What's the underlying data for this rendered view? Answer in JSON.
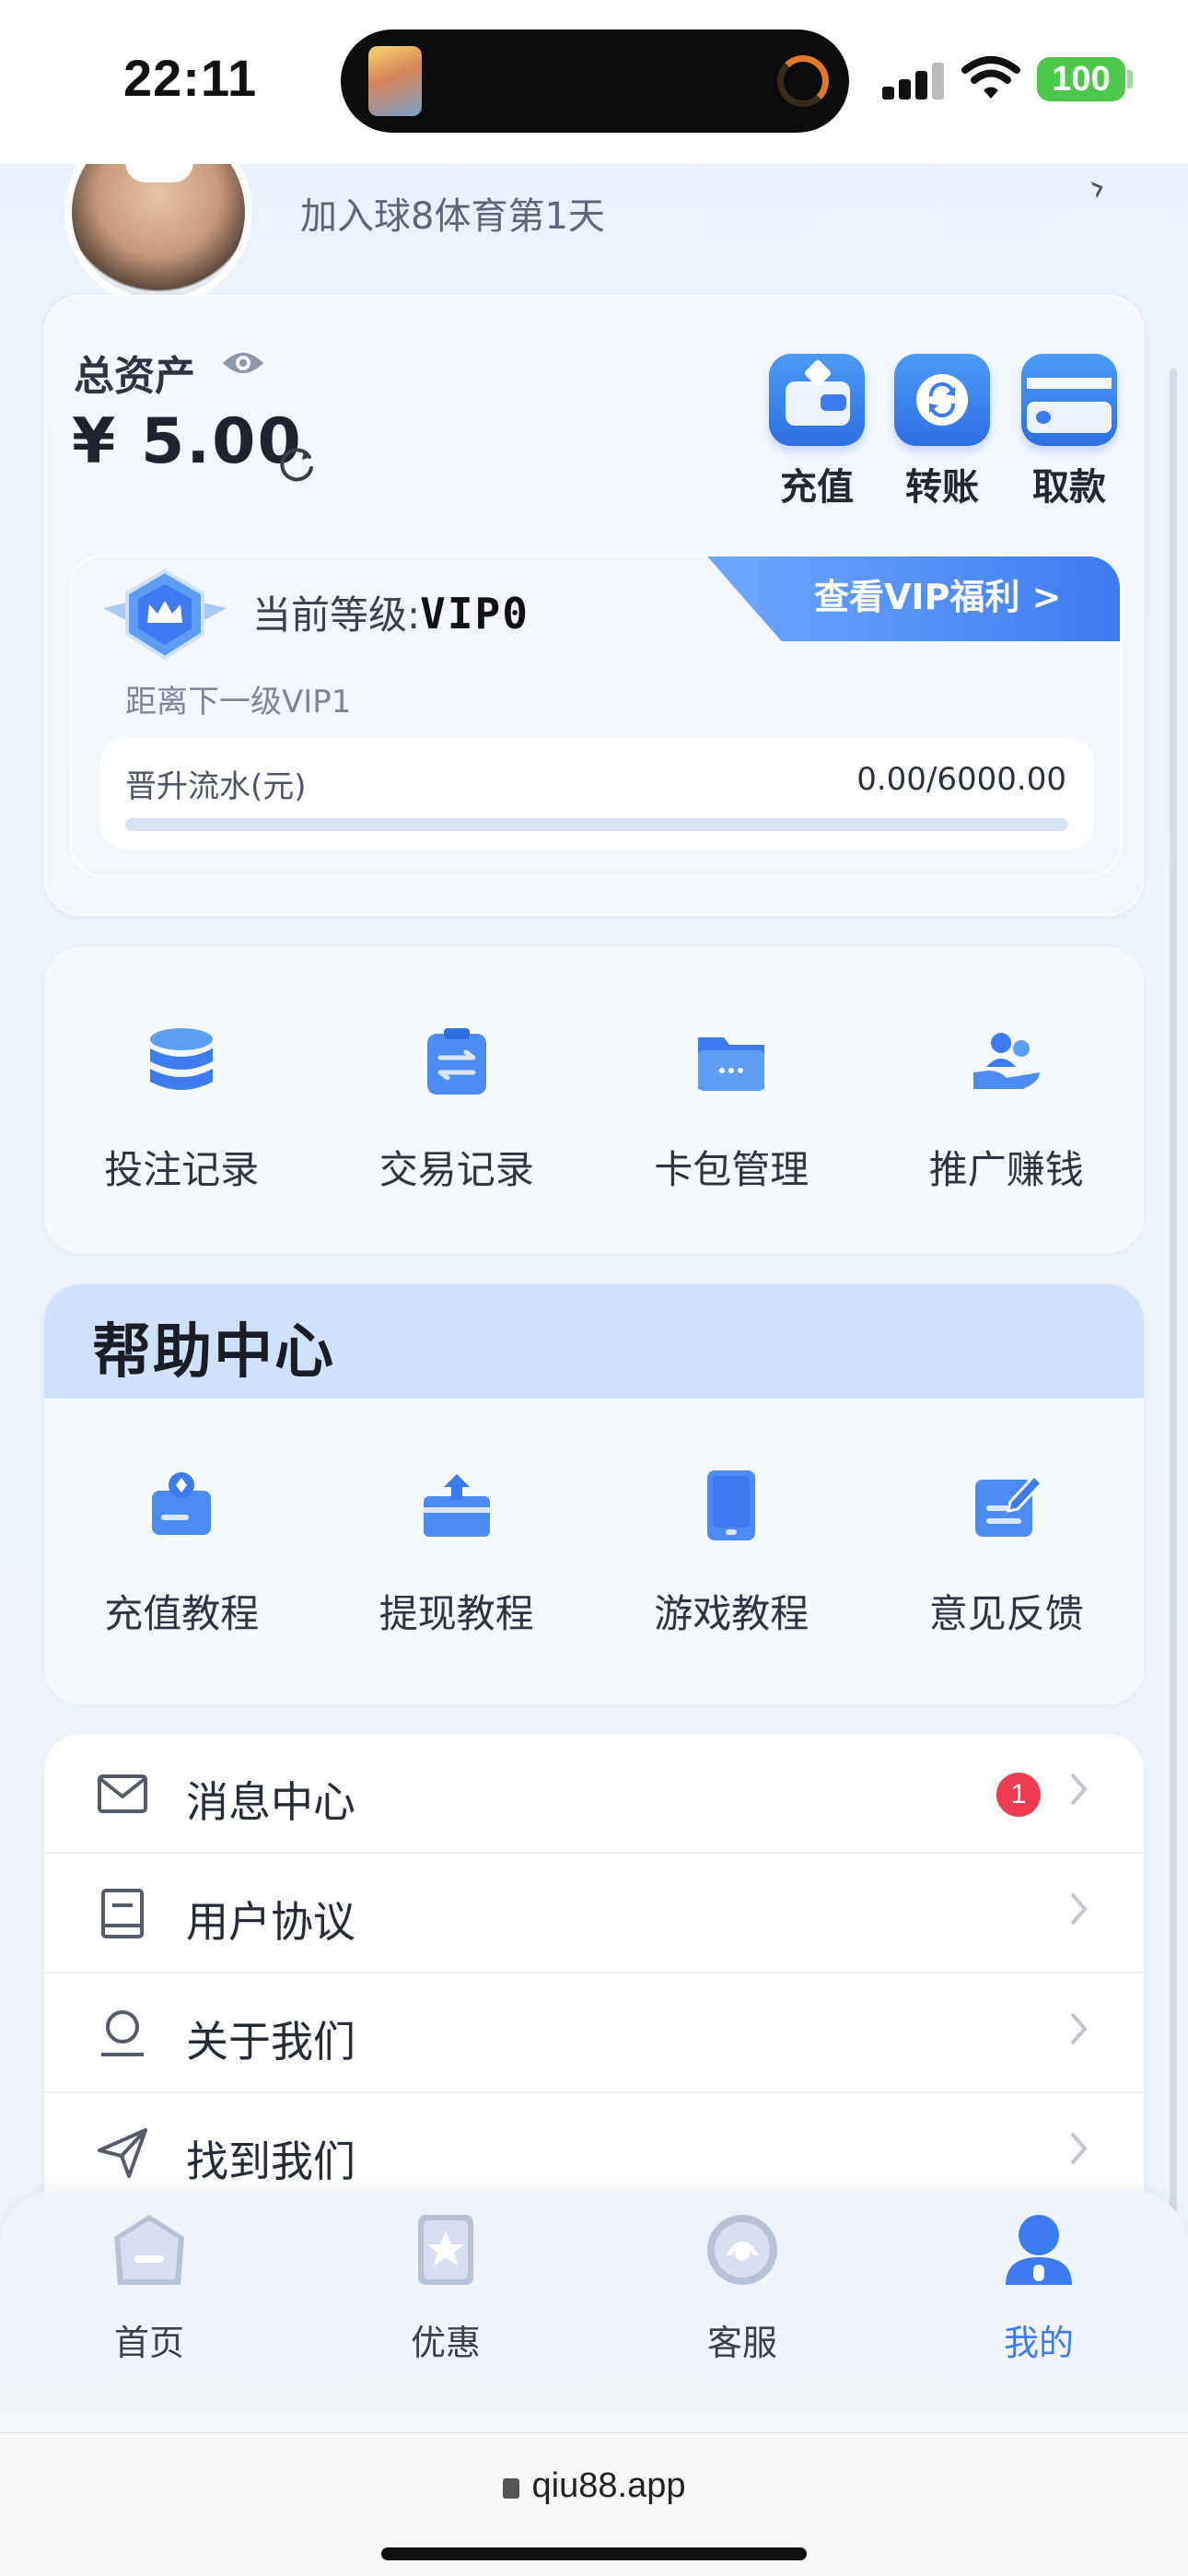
{
  "status_bar": {
    "time": "22:11",
    "battery": "100"
  },
  "profile": {
    "join_text": "加入球8体育第1天"
  },
  "assets": {
    "label": "总资产",
    "amount": "¥ 5.00",
    "actions": [
      {
        "label": "充值",
        "icon": "wallet-icon"
      },
      {
        "label": "转账",
        "icon": "transfer-icon"
      },
      {
        "label": "取款",
        "icon": "card-icon"
      }
    ]
  },
  "vip": {
    "level_prefix": "当前等级:",
    "level": "VIP0",
    "link_label": "查看VIP福利 >",
    "next_label": "距离下一级VIP1",
    "progress_label": "晋升流水(元)",
    "progress_value": "0.00/6000.00",
    "progress_fraction": 0.0
  },
  "menu": {
    "items": [
      {
        "label": "投注记录",
        "icon": "database-icon"
      },
      {
        "label": "交易记录",
        "icon": "clipboard-icon"
      },
      {
        "label": "卡包管理",
        "icon": "folder-icon"
      },
      {
        "label": "推广赚钱",
        "icon": "share-users-icon"
      }
    ]
  },
  "help": {
    "title": "帮助中心",
    "items": [
      {
        "label": "充值教程",
        "icon": "deposit-tutorial-icon"
      },
      {
        "label": "提现教程",
        "icon": "withdraw-tutorial-icon"
      },
      {
        "label": "游戏教程",
        "icon": "tablet-icon"
      },
      {
        "label": "意见反馈",
        "icon": "feedback-icon"
      }
    ]
  },
  "list": {
    "items": [
      {
        "label": "消息中心",
        "icon": "mail-icon",
        "badge": "1"
      },
      {
        "label": "用户协议",
        "icon": "book-icon"
      },
      {
        "label": "关于我们",
        "icon": "user-icon"
      },
      {
        "label": "找到我们",
        "icon": "send-icon"
      }
    ]
  },
  "tabbar": {
    "tabs": [
      {
        "label": "首页",
        "icon": "home-icon"
      },
      {
        "label": "优惠",
        "icon": "star-icon"
      },
      {
        "label": "客服",
        "icon": "support-icon"
      },
      {
        "label": "我的",
        "icon": "profile-icon",
        "active": true
      }
    ]
  },
  "browser": {
    "url": "qiu88.app"
  },
  "colors": {
    "accent": "#3d7cf0",
    "badge": "#ee3b4f",
    "help_header": "#cfe1fb"
  }
}
